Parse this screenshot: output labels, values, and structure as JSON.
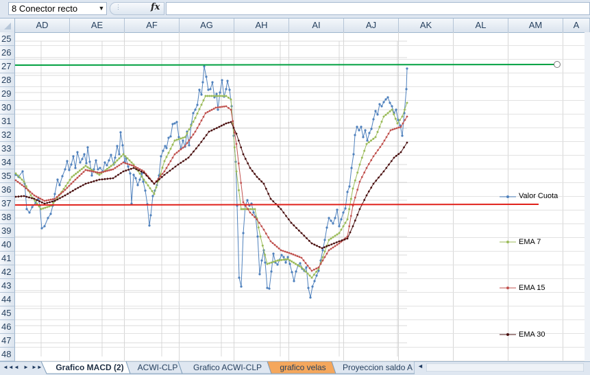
{
  "formula_bar": {
    "name_box": "8 Conector recto",
    "name_box_arrow": "▼",
    "fx_label": "fx",
    "formula": ""
  },
  "columns": [
    "AD",
    "AE",
    "AF",
    "AG",
    "AH",
    "AI",
    "AJ",
    "AK",
    "AL",
    "AM",
    "A"
  ],
  "rows": [
    "25",
    "26",
    "27",
    "28",
    "29",
    "30",
    "31",
    "32",
    "33",
    "34",
    "35",
    "36",
    "37",
    "38",
    "39",
    "40",
    "41",
    "42",
    "43",
    "44",
    "45",
    "46",
    "47",
    "48"
  ],
  "chart": {
    "legend": [
      "Valor Cuota",
      "EMA 7",
      "EMA 15",
      "EMA 30"
    ],
    "colors": {
      "valor": "#4f81bd",
      "ema7": "#9bbb59",
      "ema15": "#c0504d",
      "ema30": "#4a1010",
      "upper_line": "#00a040",
      "lower_line": "#e0201a"
    }
  },
  "chart_data": {
    "type": "line",
    "series_names": [
      "Valor Cuota",
      "EMA 7",
      "EMA 15",
      "EMA 30"
    ]
  },
  "tabs": {
    "items": [
      "Grafico MACD (2)",
      "ACWI-CLP",
      "Grafico ACWI-CLP",
      "grafico velas",
      "Proyeccion saldo A"
    ],
    "active": "Grafico MACD (2)",
    "highlight_color": "#f5a75c"
  },
  "nav": {
    "first": "◄◄",
    "prev": "◄",
    "next": "►",
    "last": "►►"
  },
  "scroll_arrow": "◄"
}
